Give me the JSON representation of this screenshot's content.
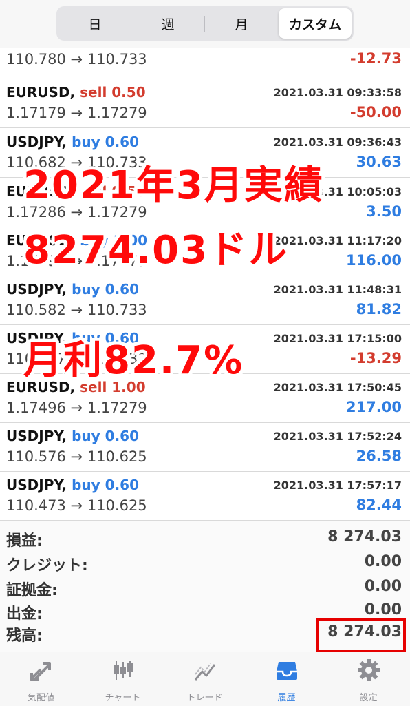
{
  "segmented": {
    "items": [
      {
        "label": "日"
      },
      {
        "label": "週"
      },
      {
        "label": "月"
      },
      {
        "label": "カスタム",
        "active": true
      }
    ]
  },
  "trades": [
    {
      "symbol": "",
      "side": "",
      "side_type": "",
      "time": "",
      "from": "110.780",
      "to": "110.733",
      "profit": "-12.73",
      "sign": "neg"
    },
    {
      "symbol": "EURUSD,",
      "side": "sell 0.50",
      "side_type": "sell",
      "time": "2021.03.31 09:33:58",
      "from": "1.17179",
      "to": "1.17279",
      "profit": "-50.00",
      "sign": "neg"
    },
    {
      "symbol": "USDJPY,",
      "side": "buy 0.60",
      "side_type": "buy",
      "time": "2021.03.31 09:36:43",
      "from": "110.682",
      "to": "110.733",
      "profit": "30.63",
      "sign": "pos"
    },
    {
      "symbol": "EURUSD,",
      "side": "sell 0.50",
      "side_type": "sell",
      "time": "2021.03.31 10:05:03",
      "from": "1.17286",
      "to": "1.17279",
      "profit": "3.50",
      "sign": "pos"
    },
    {
      "symbol": "EURUSD,",
      "side": "buy 1.00",
      "side_type": "buy",
      "time": "2021.03.31 11:17:20",
      "from": "1.17395",
      "to": "1.17279",
      "profit": "116.00",
      "sign": "pos"
    },
    {
      "symbol": "USDJPY,",
      "side": "buy 0.60",
      "side_type": "buy",
      "time": "2021.03.31 11:48:31",
      "from": "110.582",
      "to": "110.733",
      "profit": "81.82",
      "sign": "pos"
    },
    {
      "symbol": "USDJPY,",
      "side": "buy 0.60",
      "side_type": "buy",
      "time": "2021.03.31 17:15:00",
      "from": "110.757",
      "to": "110.733",
      "profit": "-13.29",
      "sign": "neg"
    },
    {
      "symbol": "EURUSD,",
      "side": "sell 1.00",
      "side_type": "sell",
      "time": "2021.03.31 17:50:45",
      "from": "1.17496",
      "to": "1.17279",
      "profit": "217.00",
      "sign": "pos"
    },
    {
      "symbol": "USDJPY,",
      "side": "buy 0.60",
      "side_type": "buy",
      "time": "2021.03.31 17:52:24",
      "from": "110.576",
      "to": "110.625",
      "profit": "26.58",
      "sign": "pos"
    },
    {
      "symbol": "USDJPY,",
      "side": "buy 0.60",
      "side_type": "buy",
      "time": "2021.03.31 17:57:17",
      "from": "110.473",
      "to": "110.625",
      "profit": "82.44",
      "sign": "pos"
    }
  ],
  "arrow": "→",
  "summary": [
    {
      "label": "損益:",
      "value": "8 274.03"
    },
    {
      "label": "クレジット:",
      "value": "0.00"
    },
    {
      "label": "証拠金:",
      "value": "0.00"
    },
    {
      "label": "出金:",
      "value": "0.00"
    },
    {
      "label": "残高:",
      "value": "8 274.03"
    }
  ],
  "overlay": {
    "line1": "2021年3月実績",
    "line2": "8274.03ドル",
    "line3": "月利82.7%"
  },
  "tabs": [
    {
      "label": "気配値",
      "icon": "quotes-icon"
    },
    {
      "label": "チャート",
      "icon": "chart-icon"
    },
    {
      "label": "トレード",
      "icon": "trade-icon"
    },
    {
      "label": "履歴",
      "icon": "history-icon",
      "active": true
    },
    {
      "label": "設定",
      "icon": "settings-icon"
    }
  ],
  "colors": {
    "sell": "#d33c2e",
    "buy": "#2f7de1",
    "overlay_text": "#ff0a0a",
    "highlight_box": "#e60000",
    "tab_active": "#2f7de1",
    "tab_inactive": "#8e8e93"
  }
}
